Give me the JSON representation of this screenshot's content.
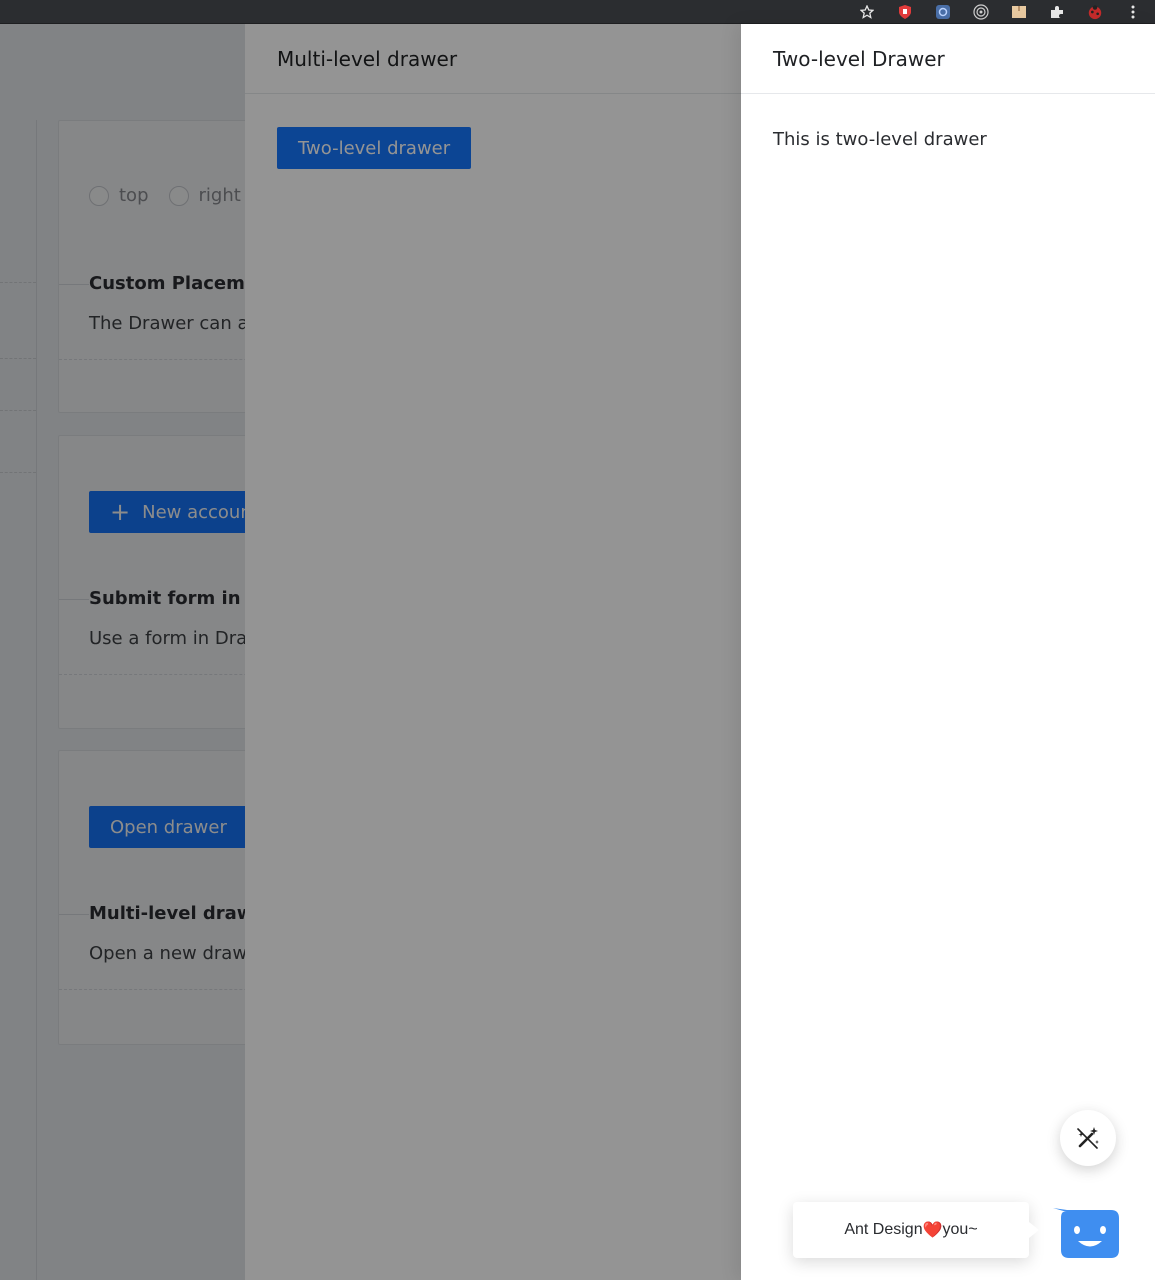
{
  "browser": {
    "icons": [
      "bookmark-star-icon",
      "shield-extension-icon",
      "gear-extension-icon",
      "target-extension-icon",
      "box-extension-icon",
      "puzzle-extensions-icon",
      "ladybug-avatar-icon",
      "kebab-menu-icon"
    ]
  },
  "page": {
    "placement_demo": {
      "radio_options": [
        "top",
        "right"
      ],
      "title": "Custom Placemen",
      "description": "The Drawer can ap"
    },
    "form_demo": {
      "button_label": "New accoun",
      "title": "Submit form in dra",
      "description": "Use a form in Draw"
    },
    "multilevel_demo": {
      "button_label": "Open drawer",
      "title": "Multi-level drawer",
      "description": "Open a new drawe"
    }
  },
  "drawer_level1": {
    "title": "Multi-level drawer",
    "button_label": "Two-level drawer"
  },
  "drawer_level2": {
    "title": "Two-level Drawer",
    "body_text": "This is two-level drawer"
  },
  "widgets": {
    "bubble_text_before": "Ant Design ",
    "bubble_heart": "❤️",
    "bubble_text_after": "you~",
    "colors": {
      "primary": "#1677ff",
      "bot": "#3f8ef0"
    }
  }
}
